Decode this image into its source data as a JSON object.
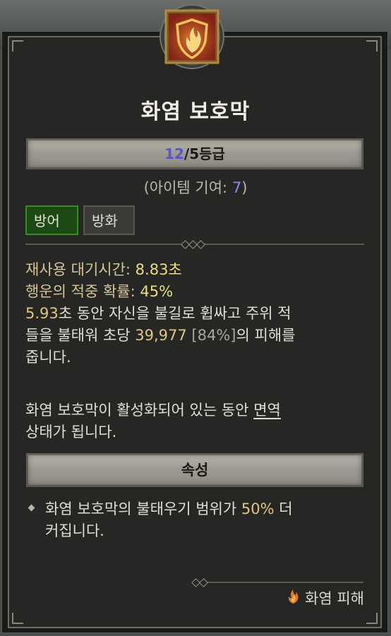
{
  "skill": {
    "name": "화염 보호막",
    "rank_current": "12",
    "rank_rest": "/5등급",
    "contribution_prefix": "(아이템 기여: ",
    "contribution_value": "7",
    "contribution_suffix": ")"
  },
  "tags": [
    "방어",
    "방화"
  ],
  "stats": {
    "cooldown_label": "재사용 대기시간: ",
    "cooldown_value": "8.83초",
    "crit_label": "행운의 적중 확률: ",
    "crit_value": "45%"
  },
  "description": {
    "l1_a": "5.93",
    "l1_b": "초 동안 자신을 불길로 휩싸고 주위 적",
    "l2_a": "들을 불태워 초당 ",
    "l2_b": "39,977",
    "l2_c": " [84%]",
    "l2_d": "의 피해를",
    "l3": "줍니다.",
    "immune_a": "화염 보호막이 활성화되어 있는 동안 ",
    "immune_b": "면역",
    "immune_c": "상태가 됩니다."
  },
  "attribute": {
    "header": "속성",
    "a1": "화염 보호막의 불태우기 범위가 ",
    "a_val": "50%",
    "a2": " 더",
    "a3": "커집니다."
  },
  "footer": {
    "damage_type": "화염 피해",
    "icon": "fire-icon"
  },
  "colors": {
    "accent_value": "#ecde7c",
    "rank_current": "#5a55c8",
    "highlight": "#e3c57c",
    "tag_active": "#1d4a14"
  }
}
